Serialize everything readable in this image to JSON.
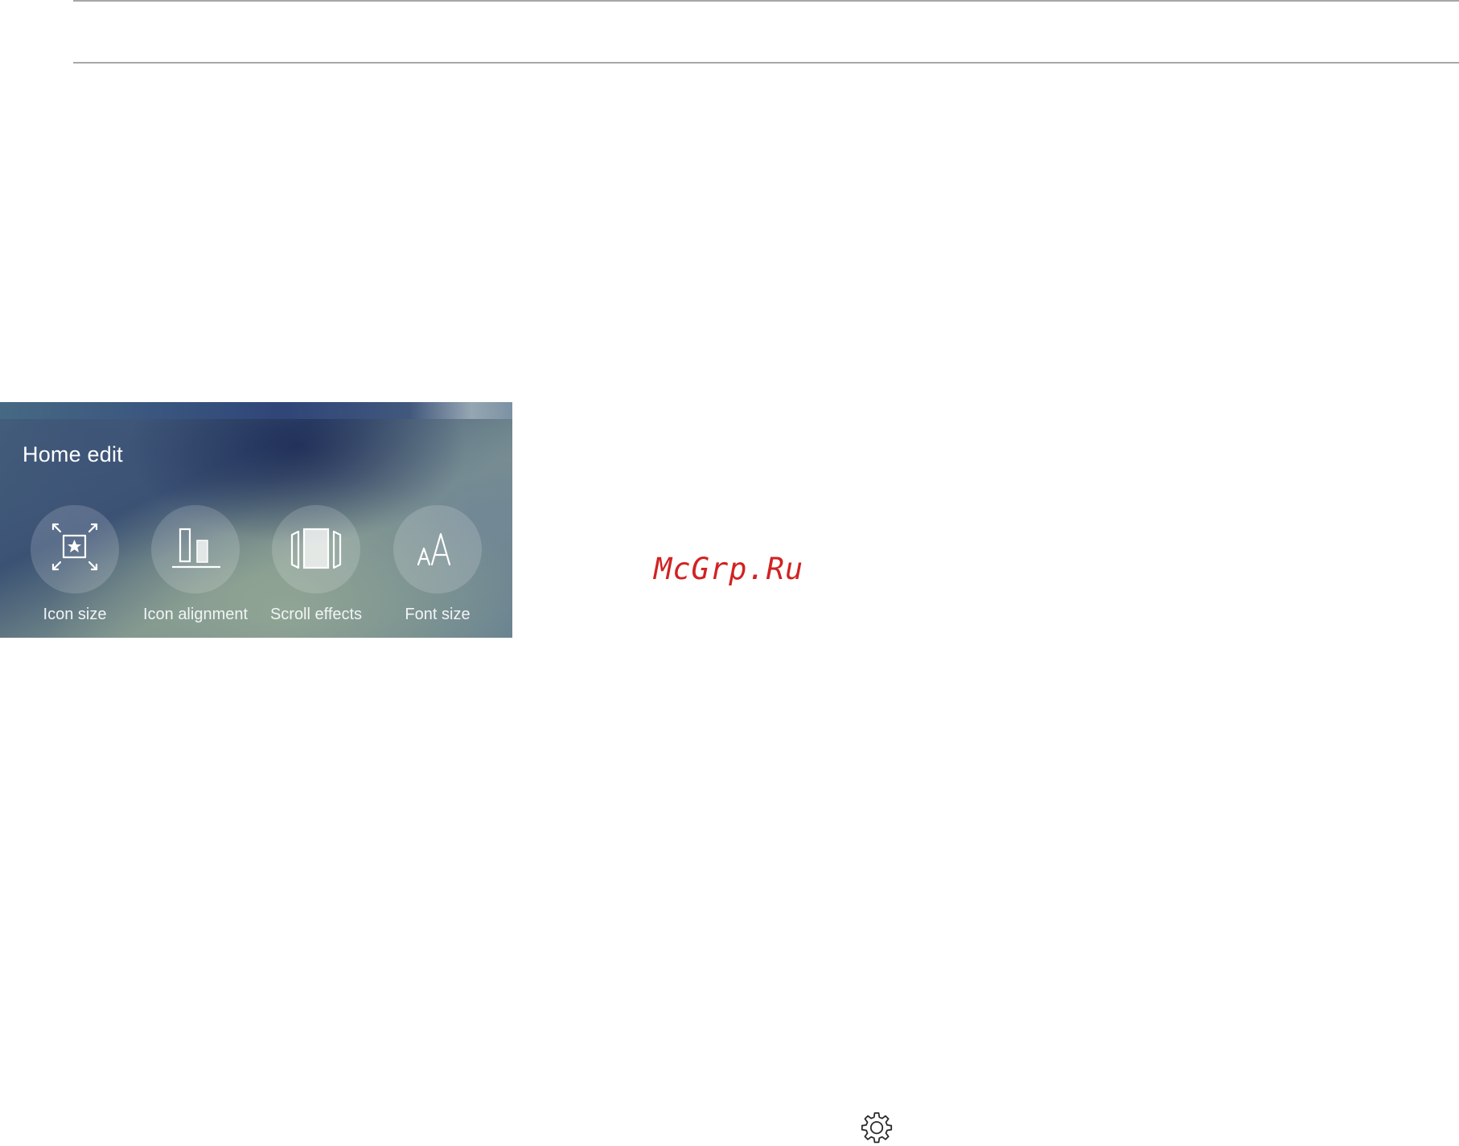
{
  "panel": {
    "title": "Home edit",
    "options": [
      {
        "label": "Icon size",
        "icon": "icon-size-icon"
      },
      {
        "label": "Icon alignment",
        "icon": "icon-alignment-icon"
      },
      {
        "label": "Scroll effects",
        "icon": "scroll-effects-icon"
      },
      {
        "label": "Font size",
        "icon": "font-size-icon"
      }
    ]
  },
  "watermark": {
    "text": "McGrp.Ru"
  },
  "bottom_icon": "settings-gear-icon"
}
